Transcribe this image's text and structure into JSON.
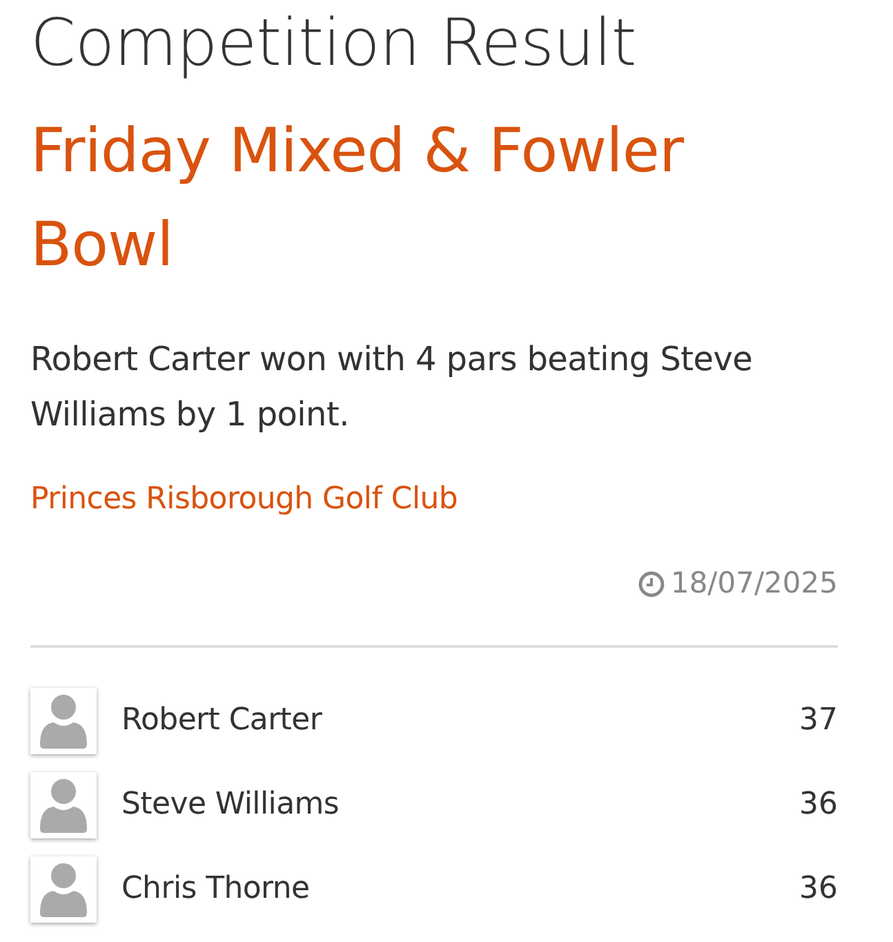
{
  "page": {
    "title": "Competition Result"
  },
  "competition": {
    "name": "Friday Mixed & Fowler Bowl",
    "summary": "Robert Carter won with 4 pars beating Steve Williams by 1 point.",
    "club": "Princes Risborough Golf Club",
    "date": "18/07/2025"
  },
  "results": [
    {
      "player": "Robert Carter",
      "score": "37"
    },
    {
      "player": "Steve Williams",
      "score": "36"
    },
    {
      "player": "Chris Thorne",
      "score": "36"
    }
  ]
}
